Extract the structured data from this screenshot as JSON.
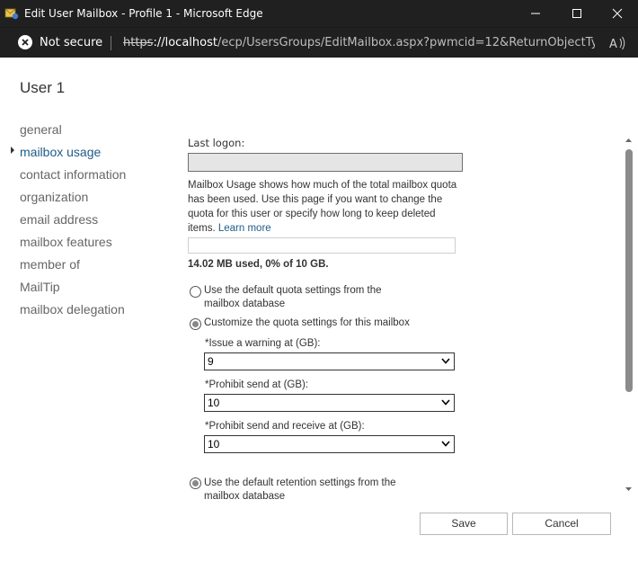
{
  "window": {
    "title": "Edit User Mailbox - Profile 1 - Microsoft Edge"
  },
  "addressbar": {
    "security_label": "Not secure",
    "url_scheme": "https",
    "url_host": "://localhost",
    "url_path": "/ecp/UsersGroups/EditMailbox.aspx?pwmcid=12&ReturnObjectTy..."
  },
  "page": {
    "user_title": "User 1"
  },
  "nav": {
    "items": [
      {
        "label": "general"
      },
      {
        "label": "mailbox usage"
      },
      {
        "label": "contact information"
      },
      {
        "label": "organization"
      },
      {
        "label": "email address"
      },
      {
        "label": "mailbox features"
      },
      {
        "label": "member of"
      },
      {
        "label": "MailTip"
      },
      {
        "label": "mailbox delegation"
      }
    ],
    "active": "mailbox usage"
  },
  "usage": {
    "last_logon_label": "Last logon:",
    "last_logon_value": "",
    "description": "Mailbox Usage shows how much of the total mailbox quota has been used. Use this page if you want to change the quota for this user or specify how long to keep deleted items.",
    "learn_more": "Learn more",
    "usage_percent": 0,
    "usage_summary": "14.02 MB used, 0% of 10 GB."
  },
  "quota": {
    "default_option": "Use the default quota settings from the mailbox database",
    "custom_option": "Customize the quota settings for this mailbox",
    "selected": "custom",
    "warning_label": "*Issue a warning at (GB):",
    "warning_value": "9",
    "prohibit_send_label": "*Prohibit send at (GB):",
    "prohibit_send_value": "10",
    "prohibit_send_receive_label": "*Prohibit send and receive at (GB):",
    "prohibit_send_receive_value": "10"
  },
  "retention": {
    "default_option": "Use the default retention settings from the mailbox database",
    "selected": "default"
  },
  "buttons": {
    "save": "Save",
    "cancel": "Cancel"
  },
  "colors": {
    "titlebar": "#202020",
    "link": "#1e5b8a",
    "text": "#333333"
  }
}
